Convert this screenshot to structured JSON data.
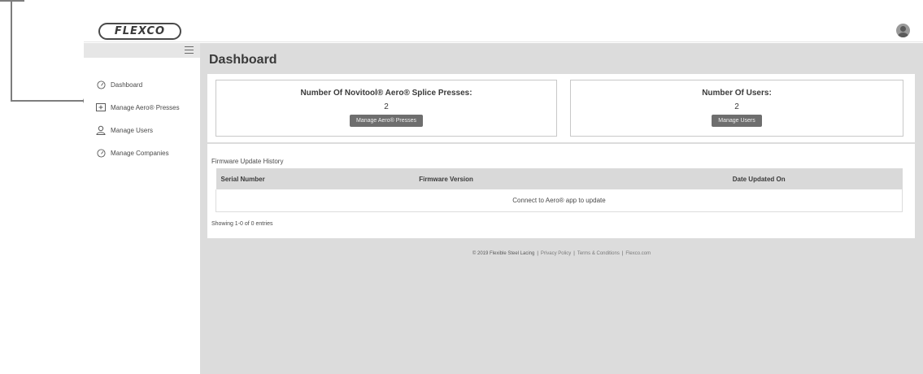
{
  "brand": {
    "logo_text": "FLEXCO"
  },
  "sidebar": {
    "items": [
      {
        "label": "Dashboard",
        "icon": "gauge-icon"
      },
      {
        "label": "Manage Aero® Presses",
        "icon": "press-icon"
      },
      {
        "label": "Manage Users",
        "icon": "user-icon"
      },
      {
        "label": "Manage Companies",
        "icon": "gauge-icon"
      }
    ]
  },
  "main": {
    "title": "Dashboard",
    "stats": [
      {
        "title": "Number Of Novitool® Aero® Splice Presses:",
        "value": "2",
        "button": "Manage Aero® Presses"
      },
      {
        "title": "Number Of Users:",
        "value": "2",
        "button": "Manage Users"
      }
    ],
    "history": {
      "label": "Firmware Update History",
      "columns": [
        "Serial Number",
        "Firmware Version",
        "Date Updated On"
      ],
      "empty_message": "Connect to Aero® app to update",
      "entries_text": "Showing 1-0 of 0 entries"
    }
  },
  "footer": {
    "copyright": "© 2019 Flexible Steel Lacing",
    "links": [
      "Privacy Policy",
      "Terms & Conditions",
      "Flexco.com"
    ]
  },
  "colors": {
    "main_bg": "#dcdcdc",
    "button_bg": "#6e6e6e",
    "table_header": "#d9d9d9",
    "callout": "#7d7d7d"
  }
}
